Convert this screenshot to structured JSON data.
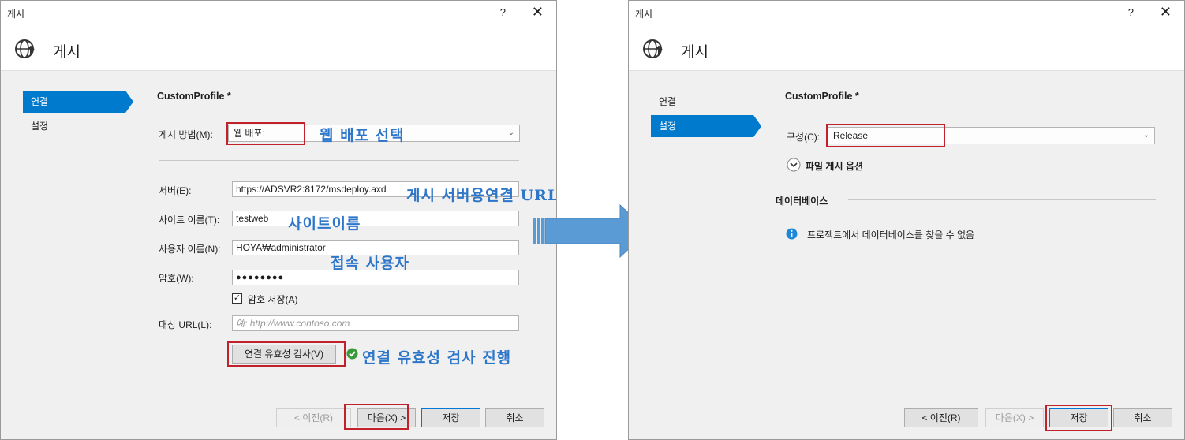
{
  "dialog_title": "게시",
  "help_label": "?",
  "close_label": "✕",
  "header_title": "게시",
  "icons": {
    "globe": "globe-publish-icon",
    "check": "check-circle-icon",
    "info": "info-icon",
    "expand": "chevron-down-circle-icon"
  },
  "colors": {
    "accent": "#007acc",
    "annotation": "#2e76c9",
    "highlight": "#c0212a",
    "arrow": "#5b9bd5"
  },
  "left": {
    "nav": [
      {
        "label": "연결"
      },
      {
        "label": "설정"
      }
    ],
    "profile": "CustomProfile *",
    "method_label": "게시 방법(M):",
    "method_value": "웹 배포:",
    "server_label": "서버(E):",
    "server_value": "https://ADSVR2:8172/msdeploy.axd",
    "site_label": "사이트 이름(T):",
    "site_value": "testweb",
    "user_label": "사용자 이름(N):",
    "user_value": "HOYA₩administrator",
    "password_label": "암호(W):",
    "password_value": "●●●●●●●●",
    "save_password_label": "암호 저장(A)",
    "dest_label": "대상 URL(L):",
    "dest_placeholder": "예: http://www.contoso.com",
    "validate_button": "연결 유효성 검사(V)",
    "buttons": {
      "prev": "< 이전(R)",
      "next": "다음(X) >",
      "save": "저장",
      "cancel": "취소"
    }
  },
  "annotations": {
    "web_deploy": "웹 배포 선택",
    "server_url": "게시 서버용연결 URL",
    "site_name": "사이트이름",
    "user": "접속 사용자",
    "validate": "연결 유효성 검사 진행"
  },
  "right": {
    "nav": [
      {
        "label": "연결"
      },
      {
        "label": "설정"
      }
    ],
    "profile": "CustomProfile *",
    "config_label": "구성(C):",
    "config_value": "Release",
    "file_options": "파일 게시 옵션",
    "db_section": "데이터베이스",
    "db_info": "프로젝트에서 데이터베이스를 찾을 수 없음",
    "buttons": {
      "prev": "< 이전(R)",
      "next": "다음(X) >",
      "save": "저장",
      "cancel": "취소"
    }
  }
}
